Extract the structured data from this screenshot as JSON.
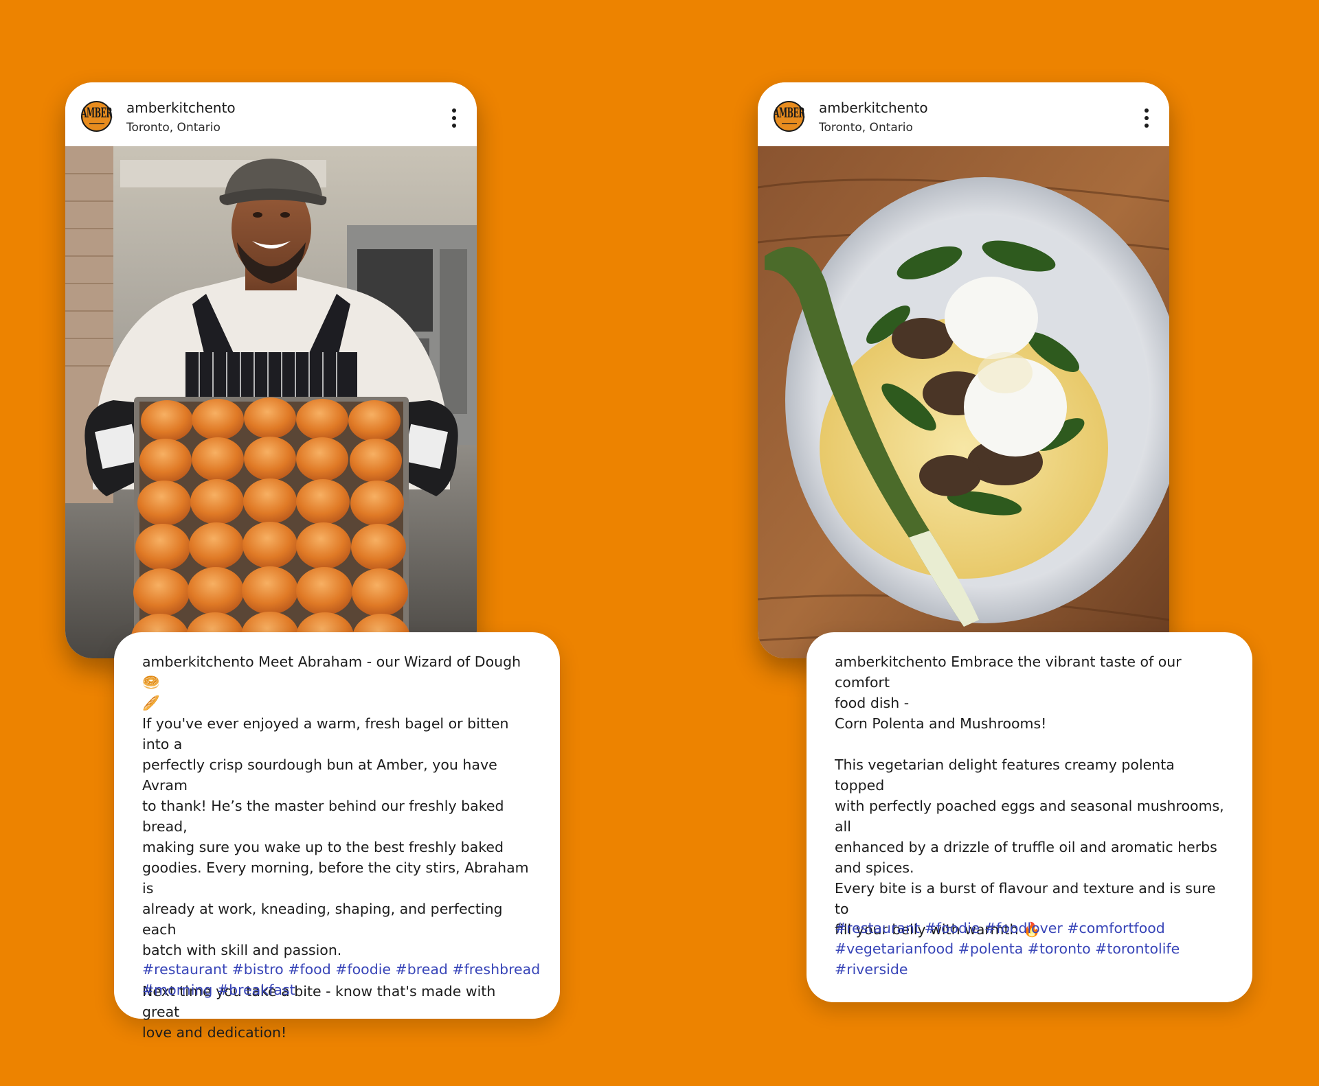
{
  "colors": {
    "background": "#ED8300",
    "hashtag": "#3845B8",
    "avatar": "#E88C1E"
  },
  "posts": [
    {
      "avatar_text": "AMBER",
      "username": "amberkitchento",
      "location": "Toronto, Ontario",
      "menu_icon": "vertical-ellipsis-icon",
      "photo": "chef holding a tray of baked buns",
      "caption_lines": [
        "amberkitchento Meet Abraham - our Wizard of Dough 🥯",
        "🥖",
        "If you've ever enjoyed a warm, fresh bagel or bitten into a",
        "perfectly crisp sourdough bun at Amber, you have Avram",
        "to thank! He’s the master behind our freshly baked bread,",
        "making sure you wake up to the best freshly baked",
        "goodies. Every morning, before the city stirs, Abraham is",
        "already at work, kneading, shaping, and perfecting each",
        "batch with skill and passion.",
        "",
        "Next time you take a bite - know that's made with great",
        "love and dedication!"
      ],
      "hashtag_lines": [
        "#restaurant #bistro #food #foodie #bread #freshbread",
        "#morning #breakfast"
      ]
    },
    {
      "avatar_text": "AMBER",
      "username": "amberkitchento",
      "location": "Toronto, Ontario",
      "menu_icon": "vertical-ellipsis-icon",
      "photo": "bowl of corn polenta with mushrooms, poached eggs and green onion",
      "caption_lines": [
        "amberkitchento Embrace the vibrant taste of our comfort",
        "food dish -",
        "Corn Polenta and Mushrooms!",
        "",
        "This vegetarian delight features creamy polenta topped",
        "with perfectly poached eggs and seasonal mushrooms, all",
        "enhanced by a drizzle of truffle oil and aromatic herbs",
        "and spices.",
        "Every bite is a burst of flavour and texture and is sure to",
        "fill your belly with warmth 🔥"
      ],
      "hashtag_lines": [
        "#restaurant #foodie #foodlover #comfortfood",
        "#vegetarianfood #polenta #toronto #torontolife",
        "#riverside"
      ]
    }
  ]
}
